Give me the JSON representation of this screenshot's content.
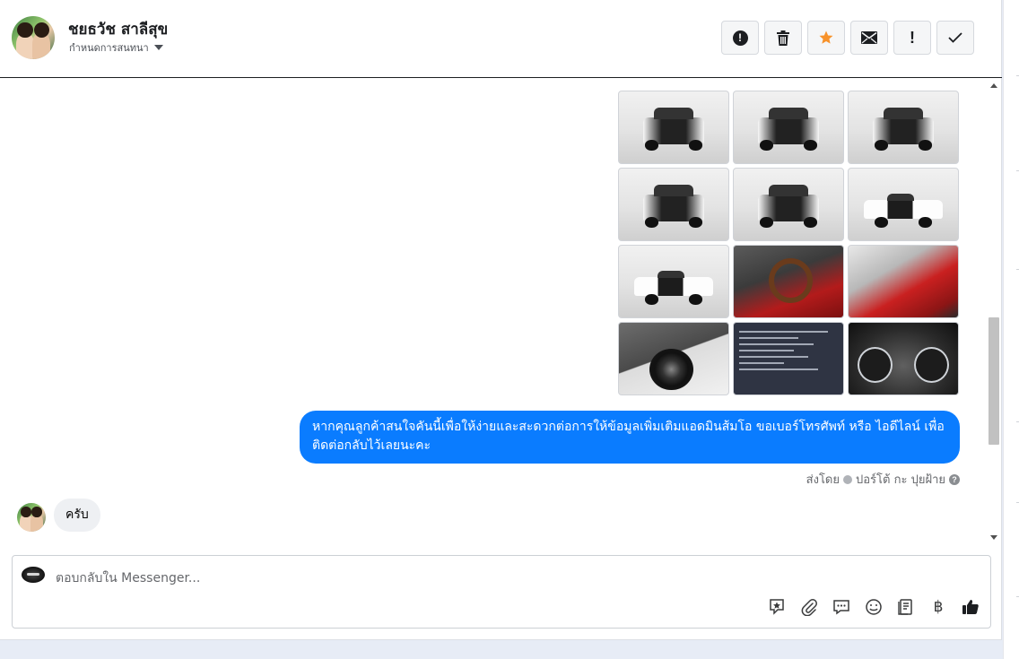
{
  "header": {
    "contact_name": "ชยธวัช สาลีสุข",
    "subtitle": "กำหนดการสนทนา",
    "actions": [
      {
        "name": "report",
        "icon": "alert-circle-icon",
        "glyph": "!"
      },
      {
        "name": "delete",
        "icon": "trash-icon"
      },
      {
        "name": "star",
        "icon": "star-icon",
        "color": "#f7922b"
      },
      {
        "name": "email",
        "icon": "envelope-icon"
      },
      {
        "name": "mark-important",
        "icon": "exclamation-icon",
        "glyph": "!"
      },
      {
        "name": "mark-done",
        "icon": "check-icon"
      }
    ]
  },
  "thread": {
    "photo_grid": [
      {
        "name": "photo-front",
        "style": "studio"
      },
      {
        "name": "photo-front-angle",
        "style": "studio"
      },
      {
        "name": "photo-rear-angle",
        "style": "studio"
      },
      {
        "name": "photo-rear",
        "style": "studio"
      },
      {
        "name": "photo-rear-side",
        "style": "studio"
      },
      {
        "name": "photo-side",
        "style": "side"
      },
      {
        "name": "photo-side-2",
        "style": "side"
      },
      {
        "name": "photo-steering",
        "style": "interior-a"
      },
      {
        "name": "photo-seats",
        "style": "interior-b"
      },
      {
        "name": "photo-wheel",
        "style": "wheel"
      },
      {
        "name": "photo-spec-sheet",
        "style": "doc"
      },
      {
        "name": "photo-gauges",
        "style": "dash"
      }
    ],
    "outgoing_message": "หากคุณลูกค้าสนใจคันนี้เพื่อให้ง่ายและสะดวกต่อการให้ข้อมูลเพิ่มเติมแอดมินส้มโอ ขอเบอร์โทรศัพท์ หรือ ไอดีไลน์ เพื่อติดต่อกลับไว้เลยนะคะ",
    "sent_by_label": "ส่งโดย",
    "sent_by_name": "ปอร์โต้ กะ ปุยฝ้าย",
    "incoming_message": "ครับ"
  },
  "composer": {
    "placeholder": "ตอบกลับใน Messenger...",
    "tools": [
      "sticker-star-icon",
      "attachment-icon",
      "saved-replies-icon",
      "emoji-icon",
      "notes-icon",
      "baht-icon",
      "thumbs-up-icon"
    ],
    "baht_glyph": "฿"
  },
  "colors": {
    "accent_blue": "#0a7cff",
    "star": "#f7922b"
  }
}
